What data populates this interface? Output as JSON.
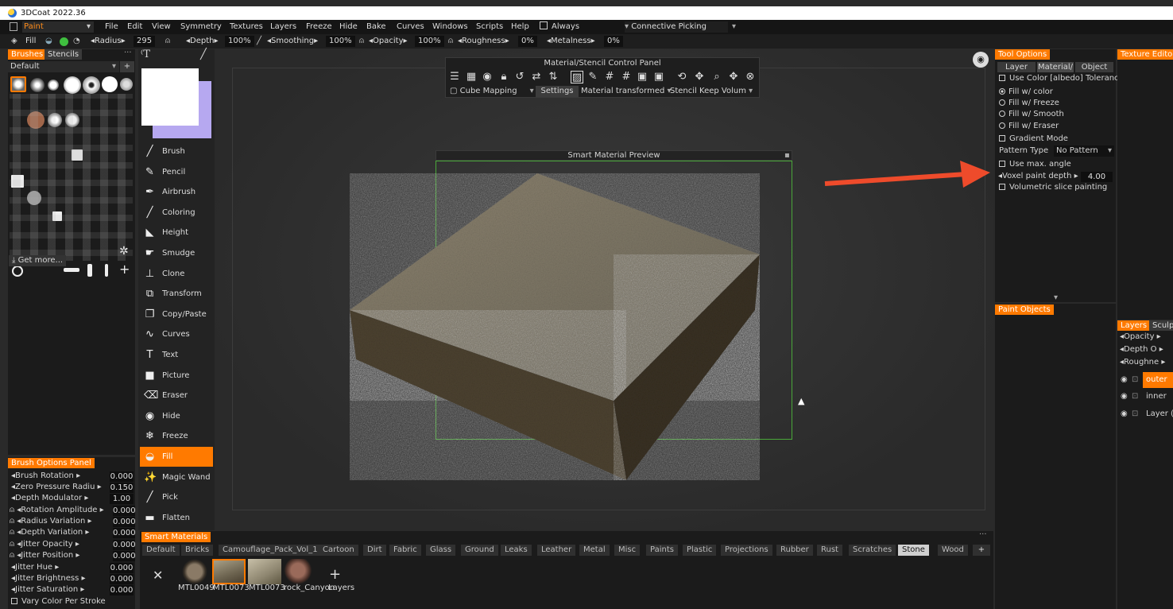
{
  "window": {
    "title": "3DCoat 2022.36"
  },
  "menubar": {
    "room": "Paint",
    "items": [
      "File",
      "Edit",
      "View",
      "Symmetry",
      "Textures",
      "Layers",
      "Freeze",
      "Hide",
      "Bake",
      "Curves",
      "Windows",
      "Scripts",
      "Help"
    ],
    "always_label": "Always",
    "connective_label": "Connective Picking"
  },
  "toolbar": {
    "tool_label": "Fill",
    "radius_label": "Radius",
    "radius_value": "295",
    "depth_label": "Depth",
    "depth_value": "100%",
    "smoothing_label": "Smoothing",
    "smoothing_value": "100%",
    "opacity_label": "Opacity",
    "opacity_value": "100%",
    "roughness_label": "Roughness",
    "roughness_value": "0%",
    "metalness_label": "Metalness",
    "metalness_value": "0%"
  },
  "brushes_panel": {
    "tab_brushes": "Brushes",
    "tab_stencils": "Stencils",
    "preset": "Default",
    "get_more": "Get more..."
  },
  "brush_options": {
    "title": "Brush Options Panel",
    "rows": [
      {
        "label": "Brush Rotation",
        "value": "0.000"
      },
      {
        "label": "Zero Pressure Radiu",
        "value": "0.150"
      },
      {
        "label": "Depth Modulator",
        "value": "1.00"
      },
      {
        "label": "Rotation Amplitude",
        "value": "0.000"
      },
      {
        "label": "Radius Variation",
        "value": "0.000"
      },
      {
        "label": "Depth Variation",
        "value": "0.000"
      },
      {
        "label": "Jitter Opacity",
        "value": "0.000"
      },
      {
        "label": "Jitter Position",
        "value": "0.000"
      },
      {
        "label": "Jitter Hue",
        "value": "0.000"
      },
      {
        "label": "Jitter Brightness",
        "value": "0.000"
      },
      {
        "label": "Jitter Saturation",
        "value": "0.000"
      }
    ],
    "vary_color": "Vary Color Per Stroke"
  },
  "tools": [
    {
      "label": "Brush",
      "icon": "brush-icon",
      "glyph": "╱"
    },
    {
      "label": "Pencil",
      "icon": "pencil-icon",
      "glyph": "✎"
    },
    {
      "label": "Airbrush",
      "icon": "airbrush-icon",
      "glyph": "✒"
    },
    {
      "label": "Coloring",
      "icon": "coloring-icon",
      "glyph": "╱"
    },
    {
      "label": "Height",
      "icon": "height-icon",
      "glyph": "◣"
    },
    {
      "label": "Smudge",
      "icon": "smudge-icon",
      "glyph": "☛"
    },
    {
      "label": "Clone",
      "icon": "clone-icon",
      "glyph": "⊥"
    },
    {
      "label": "Transform",
      "icon": "transform-icon",
      "glyph": "⧉"
    },
    {
      "label": "Copy/Paste",
      "icon": "copy-paste-icon",
      "glyph": "❐"
    },
    {
      "label": "Curves",
      "icon": "curves-icon",
      "glyph": "∿"
    },
    {
      "label": "Text",
      "icon": "text-icon",
      "glyph": "T"
    },
    {
      "label": "Picture",
      "icon": "picture-icon",
      "glyph": "■"
    },
    {
      "label": "Eraser",
      "icon": "eraser-icon",
      "glyph": "⌫"
    },
    {
      "label": "Hide",
      "icon": "eye-icon",
      "glyph": "◉"
    },
    {
      "label": "Freeze",
      "icon": "snowflake-icon",
      "glyph": "❄"
    },
    {
      "label": "Fill",
      "icon": "fill-bucket-icon",
      "glyph": "◒"
    },
    {
      "label": "Magic Wand",
      "icon": "magic-wand-icon",
      "glyph": "✨"
    },
    {
      "label": "Pick",
      "icon": "pick-icon",
      "glyph": "╱"
    },
    {
      "label": "Flatten",
      "icon": "flatten-icon",
      "glyph": "▬"
    }
  ],
  "control_panel": {
    "title": "Material/Stencil  Control  Panel",
    "cube_mapping": "Cube  Mapping",
    "settings": "Settings",
    "material": "Material",
    "transformed": "transformed",
    "stencil": "Stencil",
    "keep": "Keep",
    "volum": "Volum"
  },
  "preview": {
    "title": "Smart  Material  Preview"
  },
  "tool_options": {
    "title": "Tool Options",
    "tab_layer": "Layer",
    "tab_material": "Material/",
    "tab_object": "Object",
    "use_color": "Use  Color  [albedo]  Toleranc",
    "fill_color": "Fill  w/  color",
    "fill_freeze": "Fill  w/  Freeze",
    "fill_smooth": "Fill  w/  Smooth",
    "fill_eraser": "Fill  w/  Eraser",
    "gradient_mode": "Gradient  Mode",
    "pattern_type_label": "Pattern  Type",
    "pattern_type_value": "No  Pattern",
    "use_max_angle": "Use  max.  angle",
    "voxel_depth_label": "Voxel  paint  depth",
    "voxel_depth_value": "4.00",
    "volumetric": "Volumetric  slice  painting"
  },
  "paint_objects": {
    "title": "Paint Objects"
  },
  "texture_editor": {
    "title": "Texture Editor"
  },
  "layers_panel": {
    "tab_layers": "Layers",
    "tab_sculpt": "Sculpt",
    "opacity": "Opacity",
    "depth": "Depth  O",
    "roughness": "Roughne",
    "layers": [
      "outer",
      "inner",
      "Layer  ("
    ]
  },
  "smart_materials": {
    "title": "Smart Materials",
    "tabs": [
      "Default",
      "Bricks",
      "Camouflage_Pack_Vol_1",
      "Cartoon",
      "Dirt",
      "Fabric",
      "Glass",
      "Ground",
      "Leaks",
      "Leather",
      "Metal",
      "Misc",
      "Paints",
      "Plastic",
      "Projections",
      "Rubber",
      "Rust",
      "Scratches",
      "Stone",
      "Wood"
    ],
    "selected_tab": "Stone",
    "thumbs": [
      "MTL0049",
      "MTL0073",
      "MTL0073",
      "rock_Canyon"
    ],
    "layers_label": "Layers"
  },
  "colors": {
    "accent": "#ff7a00",
    "annotation_arrow": "#ee4b2b"
  }
}
